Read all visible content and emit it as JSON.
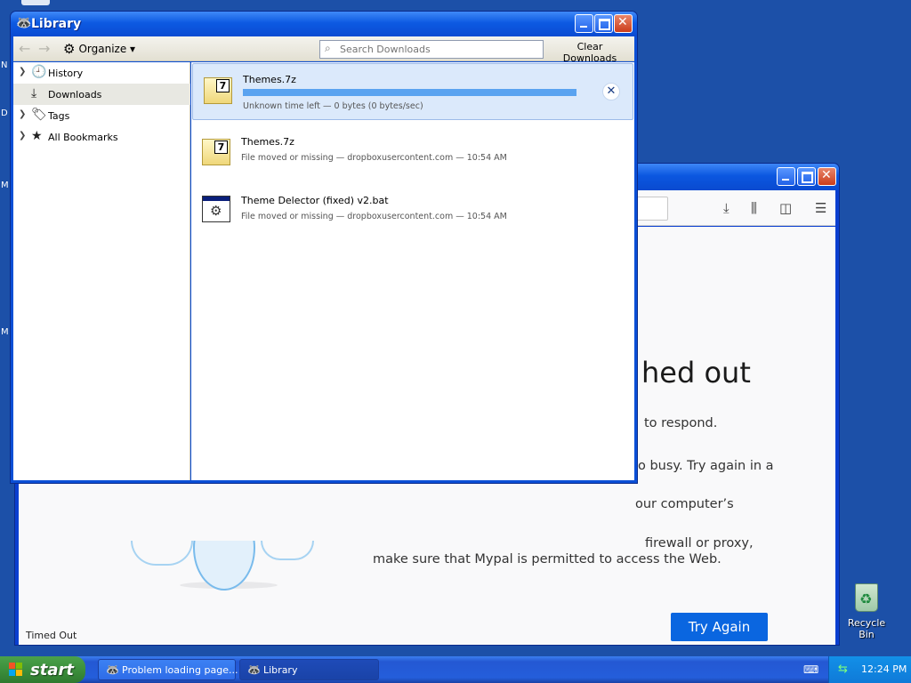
{
  "desktop": {
    "left_letters": [
      "N",
      "D",
      "M",
      "M"
    ],
    "recycle_bin_label": "Recycle Bin"
  },
  "browser": {
    "error_title": "hed out",
    "lines": [
      "to respond.",
      "o busy. Try again in a",
      "our computer’s",
      "firewall or proxy,",
      "make sure that Mypal is permitted to access the Web."
    ],
    "try_again_label": "Try Again",
    "status_text": "Timed Out"
  },
  "library": {
    "title": "Library",
    "organize_label": "Organize",
    "search_placeholder": "Search Downloads",
    "clear_label": "Clear Downloads",
    "sidebar": [
      {
        "label": "History",
        "icon": "clock-icon",
        "expandable": true
      },
      {
        "label": "Downloads",
        "icon": "download-icon",
        "expandable": false,
        "selected": true
      },
      {
        "label": "Tags",
        "icon": "tag-icon",
        "expandable": true
      },
      {
        "label": "All Bookmarks",
        "icon": "star-icon",
        "expandable": true
      }
    ],
    "downloads": [
      {
        "name": "Themes.7z",
        "status": "Unknown time left — 0 bytes (0 bytes/sec)",
        "progress_fraction": 1.0,
        "icon": "archive-7z-icon"
      },
      {
        "name": "Themes.7z",
        "status": "File moved or missing — dropboxusercontent.com — 10:54 AM",
        "icon": "archive-7z-icon"
      },
      {
        "name": "Theme Delector (fixed) v2.bat",
        "status": "File moved or missing — dropboxusercontent.com — 10:54 AM",
        "icon": "batch-file-icon"
      }
    ]
  },
  "taskbar": {
    "start_label": "start",
    "tasks": [
      {
        "label": "Problem loading page...",
        "active": false
      },
      {
        "label": "Library",
        "active": true
      }
    ],
    "clock": "12:24 PM"
  },
  "colors": {
    "desktop": "#1c50a8",
    "titlebar": "#0b57e0",
    "try_again": "#0a66e0",
    "progress": "#5aa3f0"
  }
}
